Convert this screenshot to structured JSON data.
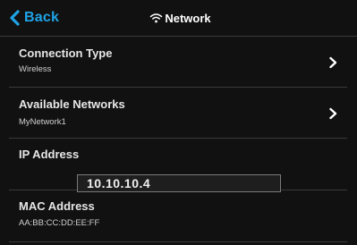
{
  "header": {
    "back_label": "Back",
    "back_icon": "chevron-left-icon",
    "title": "Network",
    "title_icon": "wifi-icon"
  },
  "rows": [
    {
      "title": "Connection Type",
      "value": "Wireless",
      "action_icon": "chevron-right-icon"
    },
    {
      "title": "Available Networks",
      "value": "MyNetwork1",
      "action_icon": "chevron-right-icon"
    },
    {
      "title": "IP Address",
      "value": "10.10.10.4"
    },
    {
      "title": "MAC Address",
      "value": "AA:BB:CC:DD:EE:FF"
    }
  ],
  "colors": {
    "accent": "#1fa3e6",
    "background": "#111111",
    "divider": "#3a3a3a"
  }
}
